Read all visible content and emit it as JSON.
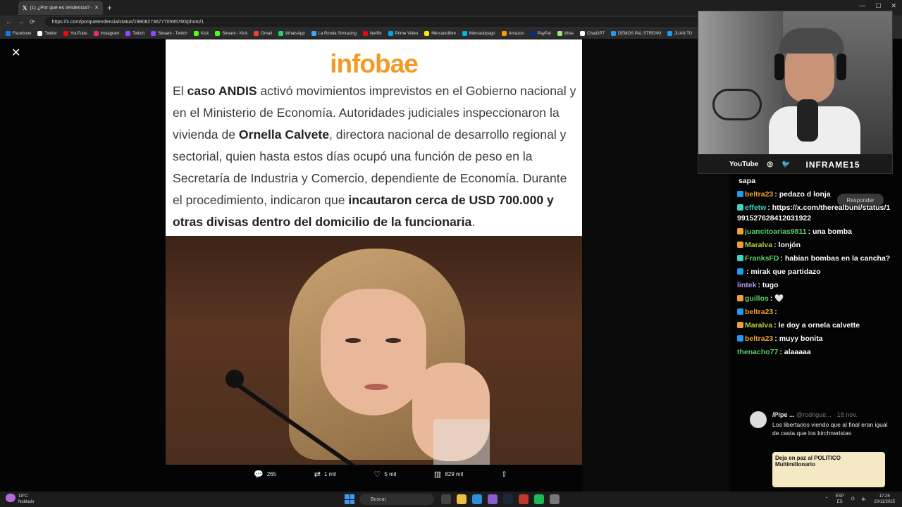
{
  "browser": {
    "tab_title": "(1) ¿Por qué es tendencia? en X:",
    "url": "https://x.com/porquetendencia/status/1990827367770595760/photo/1",
    "bookmarks": [
      {
        "label": "Facebook",
        "color": "#1877f2"
      },
      {
        "label": "Twitter",
        "color": "#ffffff"
      },
      {
        "label": "YouTube",
        "color": "#ff0000"
      },
      {
        "label": "Instagram",
        "color": "#e1306c"
      },
      {
        "label": "Twitch",
        "color": "#9146ff"
      },
      {
        "label": "Stream - Twitch",
        "color": "#9146ff"
      },
      {
        "label": "Kick",
        "color": "#53fc18"
      },
      {
        "label": "Stream - Kick",
        "color": "#53fc18"
      },
      {
        "label": "Gmail",
        "color": "#ea4335"
      },
      {
        "label": "WhatsApp",
        "color": "#25d366"
      },
      {
        "label": "La Ronda Simracing",
        "color": "#3fa9f5"
      },
      {
        "label": "Netflix",
        "color": "#e50914"
      },
      {
        "label": "Prime Video",
        "color": "#00a8e1"
      },
      {
        "label": "Mercadolibre",
        "color": "#ffe600"
      },
      {
        "label": "Mercadopago",
        "color": "#00b1ea"
      },
      {
        "label": "Amazon",
        "color": "#ff9900"
      },
      {
        "label": "PayPal",
        "color": "#003087"
      },
      {
        "label": "Wise",
        "color": "#9fe870"
      },
      {
        "label": "ChatGPT",
        "color": "#ffffff"
      },
      {
        "label": "DEMOS PAL STREAM",
        "color": "#1d9bf0"
      },
      {
        "label": "JUAN TU",
        "color": "#1d9bf0"
      }
    ]
  },
  "article": {
    "logo": "infobae",
    "p1": "El ",
    "b1": "caso ANDIS",
    "p2": " activó movimientos imprevistos en el Gobierno nacional y en el Ministerio de Economía. Autoridades judiciales inspeccionaron la vivienda de ",
    "b2": "Ornella Calvete",
    "p3": ", directora nacional de desarrollo regional y sectorial, quien hasta estos días ocupó una función de peso en la Secretaría de Industria y Comercio, dependiente de Economía. Durante el procedimiento, indicaron que ",
    "b3": "incautaron cerca de USD 700.000 y otras divisas dentro del domicilio de la funcionaria",
    "p4": "."
  },
  "actions": {
    "replies": "265",
    "reposts": "1 mil",
    "likes": "5 mil",
    "views": "829 mil"
  },
  "cam": {
    "youtube": "YouTube",
    "brand": "INFRAME15"
  },
  "chat": [
    {
      "user": "",
      "text": "sapa",
      "color": "#ffffff",
      "badge": ""
    },
    {
      "user": "beltra23",
      "text": ": pedazo d lonja",
      "color": "#f0a030",
      "badge": "#1d9bf0"
    },
    {
      "user": "effetw",
      "text": ": https://x.com/therealbuni/status/1991527628412031922",
      "color": "#3fd6c0",
      "badge": "#3fd6c0"
    },
    {
      "user": "juancitoarias9811",
      "text": ": una bomba",
      "color": "#5bd16a",
      "badge": "#f0a030"
    },
    {
      "user": "Maralva",
      "text": ": lonjón",
      "color": "#b0d040",
      "badge": "#f0a030"
    },
    {
      "user": "FranksFD",
      "text": ": habian bombas en la cancha?",
      "color": "#5bd16a",
      "badge": "#3fd6c0"
    },
    {
      "user": "",
      "text": ": mirak que partidazo",
      "color": "#e04040",
      "badge": "#1d9bf0"
    },
    {
      "user": "lintek",
      "text": ": tugo",
      "color": "#b49af0",
      "badge": ""
    },
    {
      "user": "guillos",
      "text": ": 🤍",
      "color": "#5bd16a",
      "badge": "#f0a030"
    },
    {
      "user": "beltra23",
      "text": ":",
      "color": "#f0a030",
      "badge": "#1d9bf0"
    },
    {
      "user": "Maralva",
      "text": ": le doy a ornela calvette",
      "color": "#b0d040",
      "badge": "#f0a030"
    },
    {
      "user": "beltra23",
      "text": ": muyy bonita",
      "color": "#f0a030",
      "badge": "#1d9bf0"
    },
    {
      "user": "thenacho77",
      "text": ": alaaaaa",
      "color": "#5bd16a",
      "badge": ""
    }
  ],
  "respond_label": "Responder",
  "tweet": {
    "name": "/Pipe ...",
    "handle": "@rodrigue... · 18 nov.",
    "body": "Los libertarios viendo que al final eran igual de casta que los kirchneristas",
    "meme": "Deja en paz al POLITICO Multimillonario"
  },
  "taskbar": {
    "temp": "18°C",
    "weather": "Nublado",
    "search": "Buscar",
    "lang": "ESP\nES",
    "time": "17:26",
    "date": "20/11/2025"
  }
}
